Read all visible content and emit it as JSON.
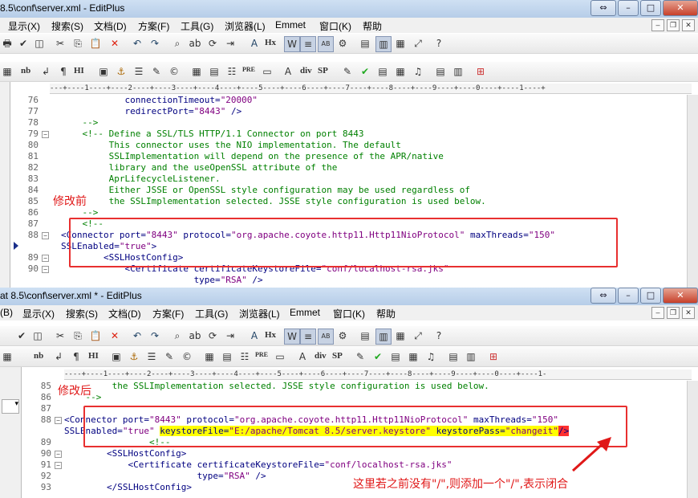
{
  "windows": [
    {
      "title": "8.5\\conf\\server.xml - EditPlus",
      "menu": [
        "显示(X)",
        "搜索(S)",
        "文档(D)",
        "方案(F)",
        "工具(G)",
        "浏览器(L)",
        "Emmet",
        "窗口(K)",
        "帮助"
      ],
      "ruler": "---+----1----+----2----+----3----+----4----+----5----+----6----+----7----+----8----+----9----+----0----+----1----+",
      "annotation": "修改前",
      "lines": [
        {
          "n": "76",
          "text": "            connectionTimeout=\"20000\""
        },
        {
          "n": "77",
          "text": "            redirectPort=\"8443\" />"
        },
        {
          "n": "78",
          "text": "    -->"
        },
        {
          "n": "79",
          "text": "    <!-- Define a SSL/TLS HTTP/1.1 Connector on port 8443"
        },
        {
          "n": "80",
          "text": "         This connector uses the NIO implementation. The default"
        },
        {
          "n": "81",
          "text": "         SSLImplementation will depend on the presence of the APR/native"
        },
        {
          "n": "82",
          "text": "         library and the useOpenSSL attribute of the"
        },
        {
          "n": "83",
          "text": "         AprLifecycleListener."
        },
        {
          "n": "84",
          "text": "         Either JSSE or OpenSSL style configuration may be used regardless of"
        },
        {
          "n": "85",
          "text": "         the SSLImplementation selected. JSSE style configuration is used below."
        },
        {
          "n": "86",
          "text": "    -->"
        },
        {
          "n": "87",
          "text": "    <!--"
        },
        {
          "n": "88",
          "text": "<Connector port=\"8443\" protocol=\"org.apache.coyote.http11.Http11NioProtocol\" maxThreads=\"150\""
        },
        {
          "n": "",
          "text": "SSLEnabled=\"true\">"
        },
        {
          "n": "89",
          "text": "        <SSLHostConfig>"
        },
        {
          "n": "90",
          "text": "            <Certificate certificateKeystoreFile=\"conf/localhost-rsa.jks\""
        },
        {
          "n": "",
          "text": "                         type=\"RSA\" />"
        }
      ]
    },
    {
      "title": "at 8.5\\conf\\server.xml * - EditPlus",
      "menu": [
        "(B)",
        "显示(X)",
        "搜索(S)",
        "文档(D)",
        "方案(F)",
        "工具(G)",
        "浏览器(L)",
        "Emmet",
        "窗口(K)",
        "帮助"
      ],
      "ruler": "----+----1----+----2----+----3----+----4----+----5----+----6----+----7----+----8----+----9----+----0----+----1-",
      "annotation": "修改后",
      "lines": [
        {
          "n": "85",
          "text": "         the SSLImplementation selected. JSSE style configuration is used below."
        },
        {
          "n": "86",
          "text": "    -->"
        },
        {
          "n": "87",
          "text": ""
        },
        {
          "n": "88",
          "text": "<Connector port=\"8443\" protocol=\"org.apache.coyote.http11.Http11NioProtocol\" maxThreads=\"150\""
        },
        {
          "n": "",
          "text": "SSLEnabled=\"true\" keystoreFile=\"E:/apache/Tomcat 8.5/server.keystore\" keystorePass=\"changeit\"/>"
        },
        {
          "n": "89",
          "text": "                <!--"
        },
        {
          "n": "90",
          "text": "        <SSLHostConfig>"
        },
        {
          "n": "91",
          "text": "            <Certificate certificateKeystoreFile=\"conf/localhost-rsa.jks\""
        },
        {
          "n": "92",
          "text": "                         type=\"RSA\" />"
        },
        {
          "n": "93",
          "text": "        </SSLHostConfig>"
        }
      ],
      "callout": "这里若之前没有\"/\",则添加一个\"/\",表示闭合"
    }
  ],
  "colors": {
    "annotation": "#e01818",
    "highlight": "#ffff00",
    "comment": "#008000",
    "tag": "#000080",
    "value": "#800080"
  },
  "icons": [
    "print-icon",
    "spellcheck-icon",
    "cut-icon",
    "copy-icon",
    "paste-icon",
    "delete-icon",
    "undo-icon",
    "redo-icon",
    "find-icon",
    "replace-icon",
    "font-icon",
    "wordwrap-icon",
    "settings-icon",
    "help-icon"
  ]
}
